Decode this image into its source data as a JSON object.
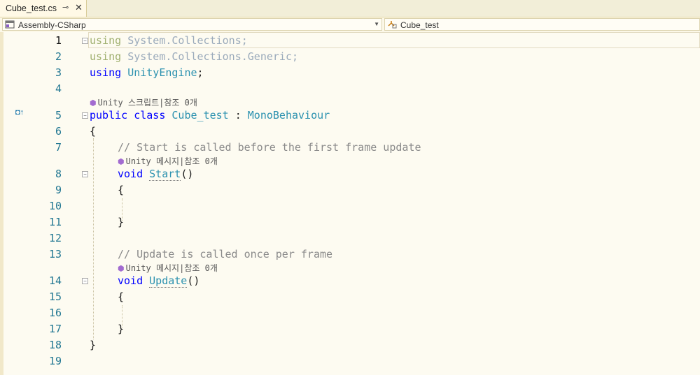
{
  "tab": {
    "filename": "Cube_test.cs",
    "pin": "⊸",
    "close": "✕"
  },
  "nav": {
    "project": "Assembly-CSharp",
    "class": "Cube_test"
  },
  "gutter_marker": "◘↑",
  "lens": {
    "script": "Unity 스크립트|참조 0개",
    "message": "Unity 메시지|참조 0개"
  },
  "lines": [
    {
      "n": "1"
    },
    {
      "n": "2"
    },
    {
      "n": "3"
    },
    {
      "n": "4"
    },
    {
      "n": "5"
    },
    {
      "n": "6"
    },
    {
      "n": "7"
    },
    {
      "n": "8"
    },
    {
      "n": "9"
    },
    {
      "n": "10"
    },
    {
      "n": "11"
    },
    {
      "n": "12"
    },
    {
      "n": "13"
    },
    {
      "n": "14"
    },
    {
      "n": "15"
    },
    {
      "n": "16"
    },
    {
      "n": "17"
    },
    {
      "n": "18"
    },
    {
      "n": "19"
    }
  ],
  "code": {
    "using": "using",
    "ns1": "System.Collections",
    "ns2": "System.Collections.Generic",
    "ns3": "UnityEngine",
    "semi": ";",
    "public": "public",
    "class": "class",
    "classname": "Cube_test",
    "colon": " : ",
    "base": "MonoBehaviour",
    "brace_open": "{",
    "brace_close": "}",
    "comment_start": "// Start is called before the first frame update",
    "void": "void",
    "start": "Start",
    "parens": "()",
    "comment_update": "// Update is called once per frame",
    "update": "Update"
  }
}
